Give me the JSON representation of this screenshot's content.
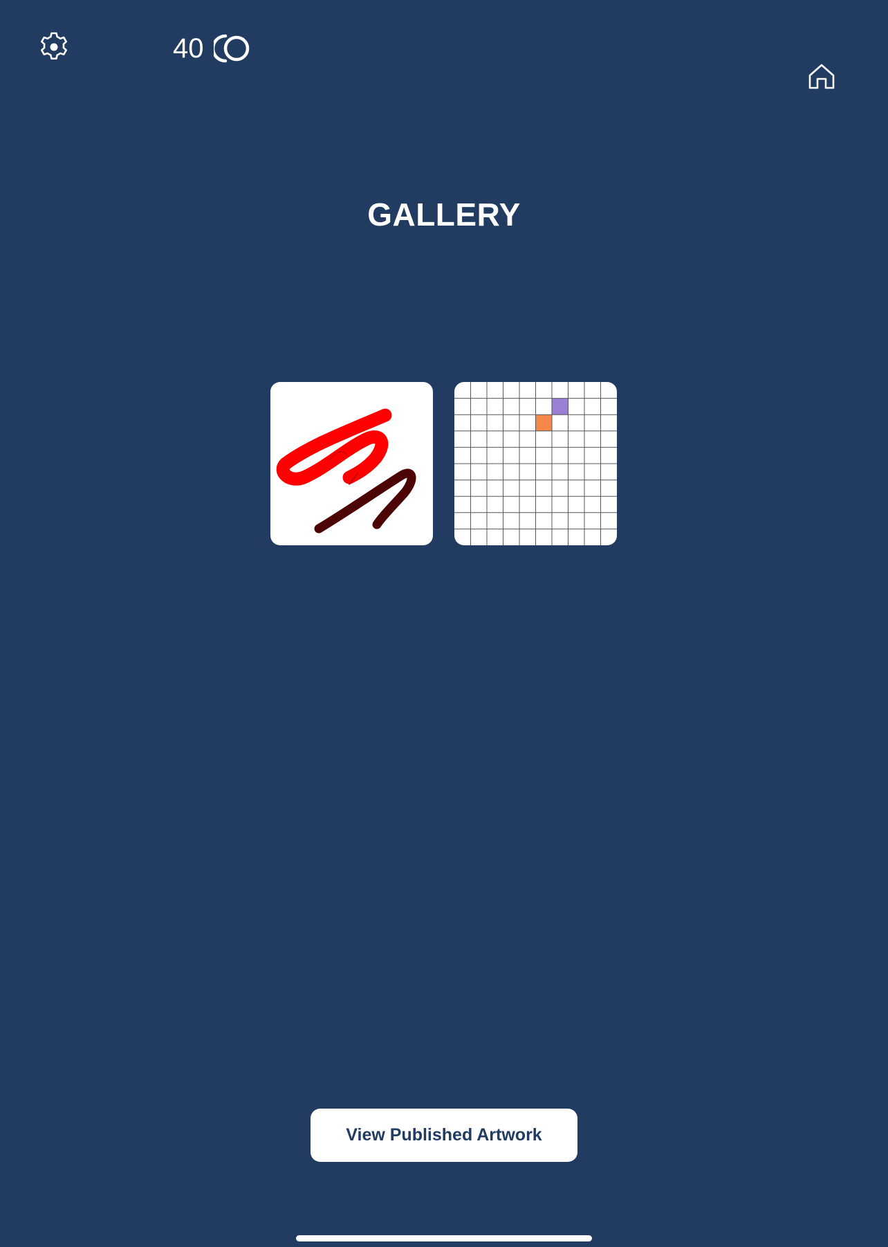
{
  "theme": {
    "background": "#223b61",
    "button_text": "#223b61",
    "foreground": "#ffffff"
  },
  "header": {
    "settings_icon": "gear-icon",
    "coin_count": "40",
    "coin_icon": "coin-icon",
    "home_icon": "home-icon"
  },
  "page": {
    "title": "GALLERY"
  },
  "gallery": {
    "artworks": [
      {
        "type": "freehand-drawing",
        "stroke_colors": [
          "#ff0000",
          "#4d0404"
        ]
      },
      {
        "type": "pixel-grid",
        "grid_size": 10,
        "filled_cells": [
          {
            "col": 6,
            "row": 1,
            "color": "#9b7fd4"
          },
          {
            "col": 5,
            "row": 2,
            "color": "#f4894a"
          }
        ]
      }
    ]
  },
  "footer": {
    "view_published_label": "View Published Artwork"
  }
}
